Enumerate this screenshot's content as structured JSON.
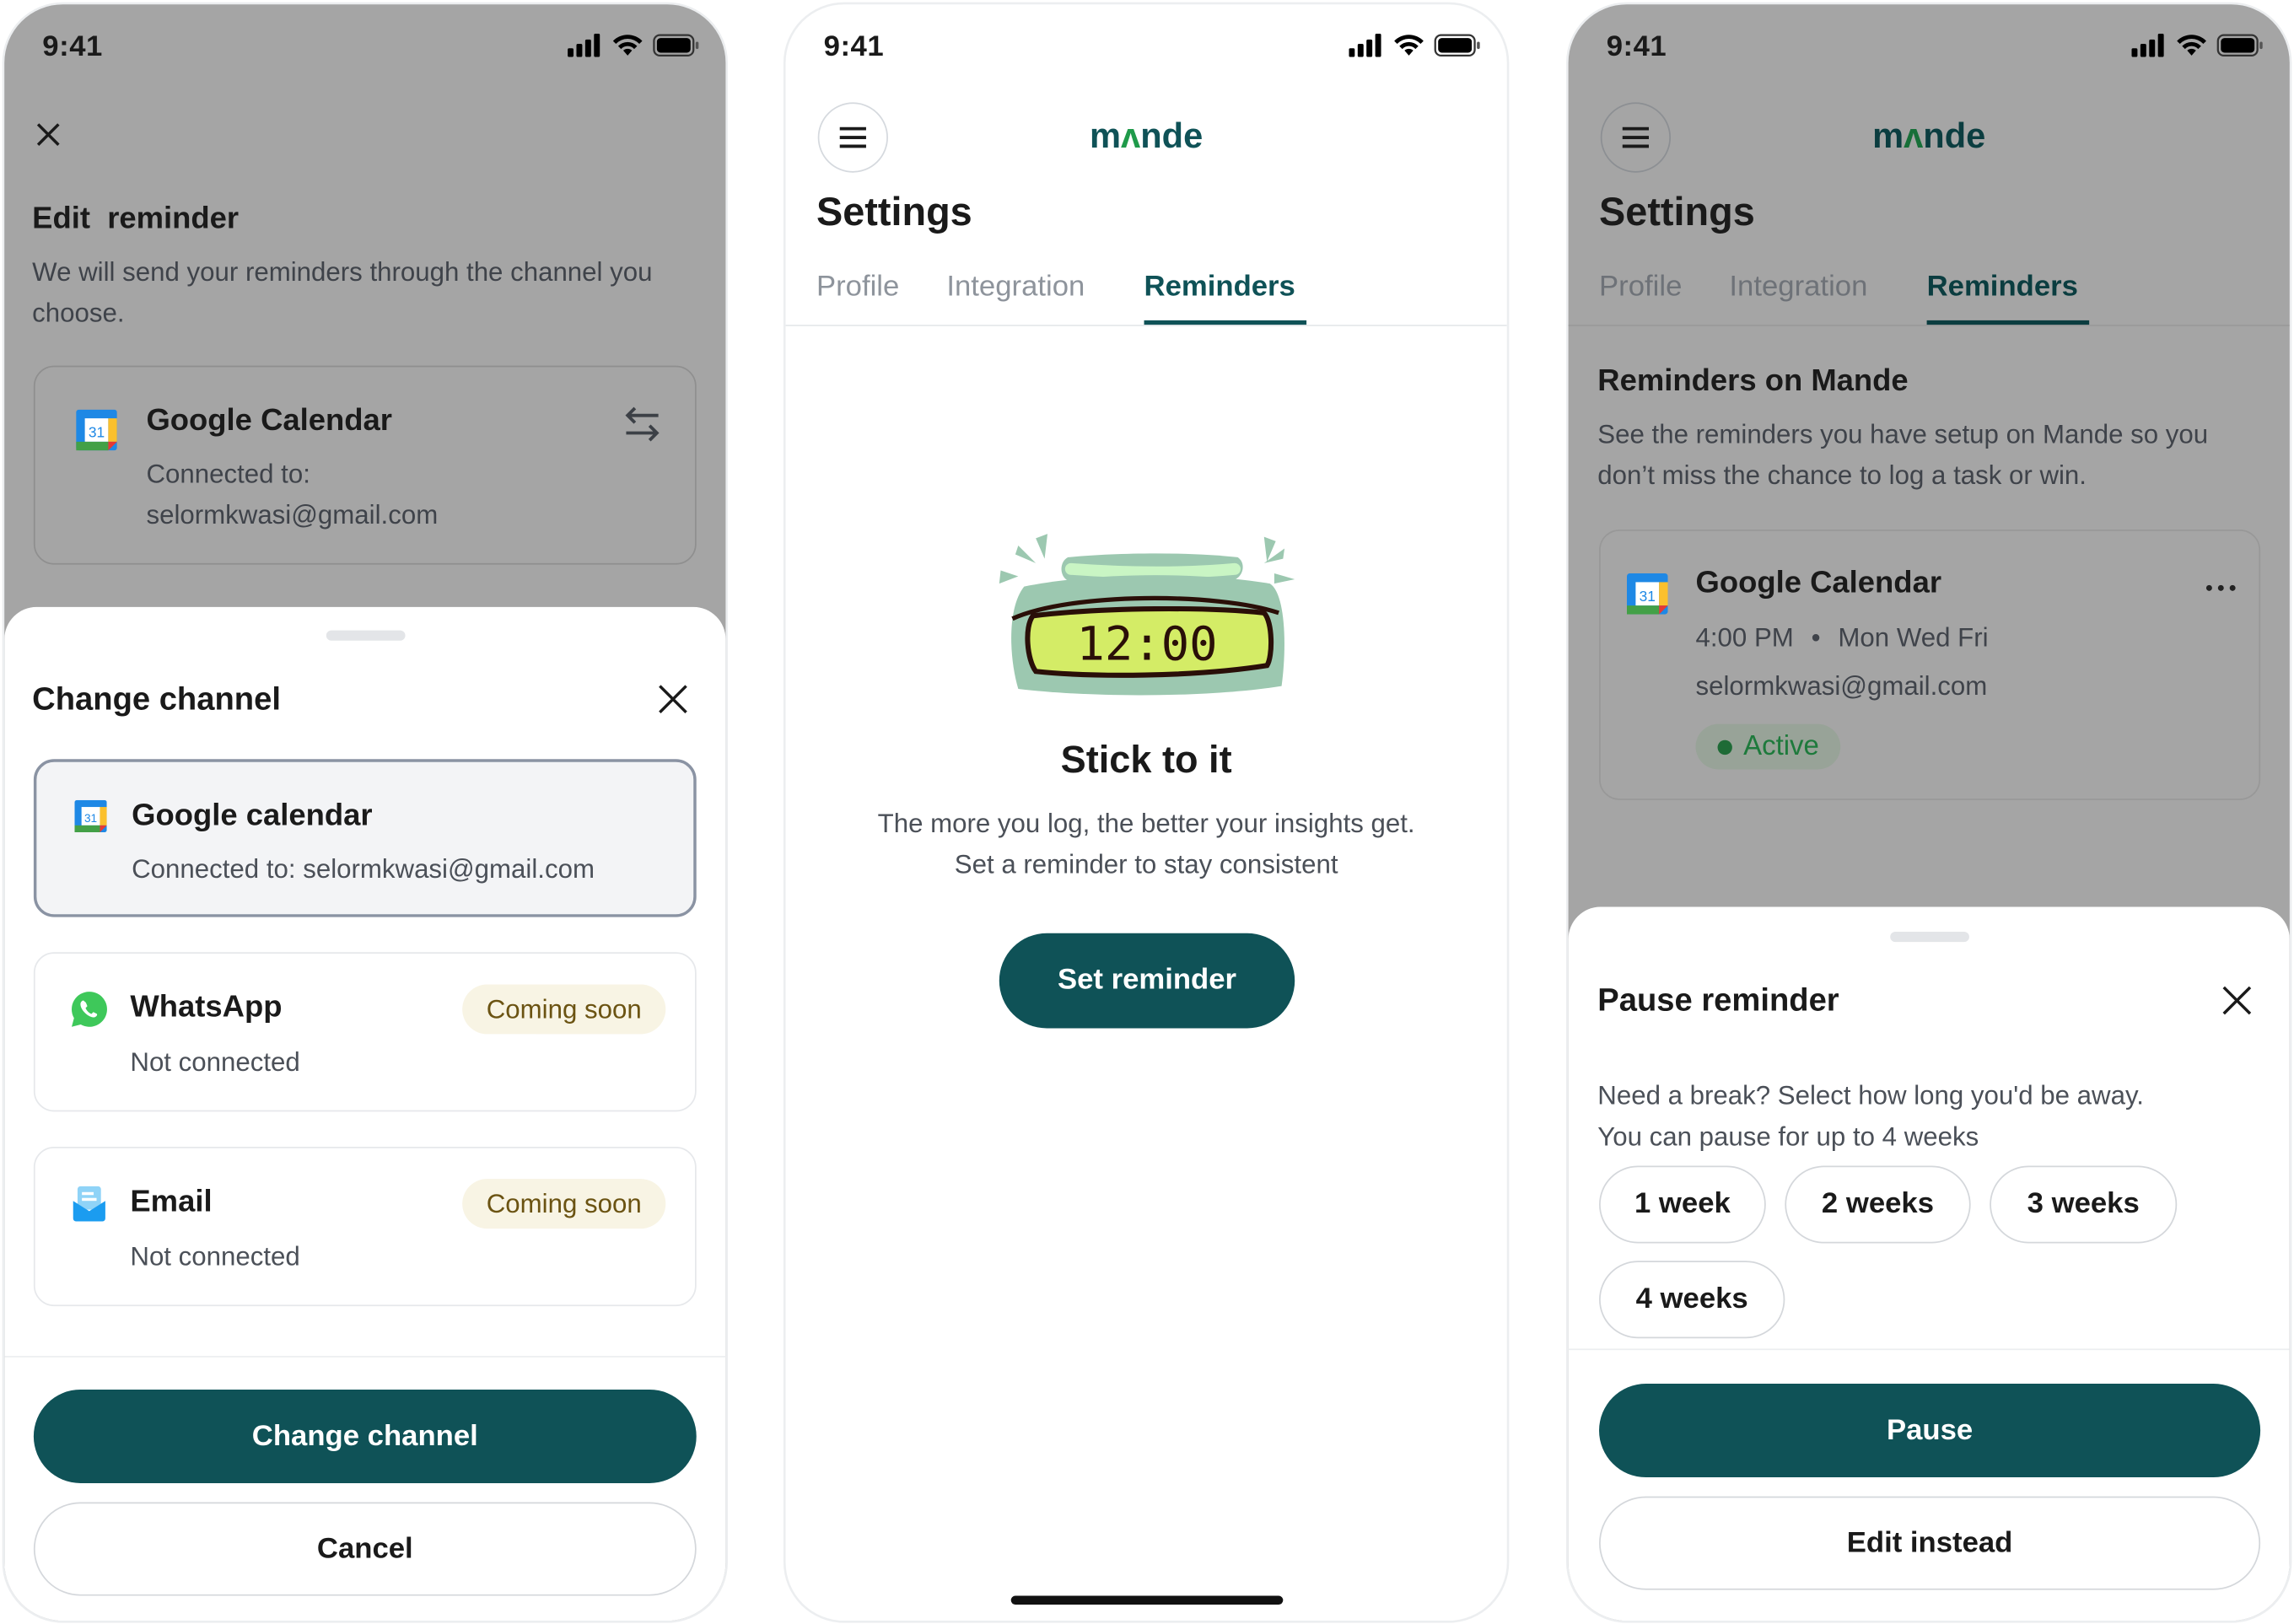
{
  "status_bar": {
    "time": "9:41"
  },
  "brand": {
    "logo": "mande",
    "accent": "#0f5257",
    "logo_accent": "#1f9a4a"
  },
  "screen1": {
    "title": "Edit  reminder",
    "description": "We will send your reminders through the channel you choose.",
    "current_channel": {
      "name": "Google Calendar",
      "connected_label": "Connected to:",
      "email": "selormkwasi@gmail.com",
      "icon": "google-calendar-icon",
      "action_icon": "swap-icon"
    },
    "sheet": {
      "title": "Change channel",
      "options": [
        {
          "name": "Google calendar",
          "subtitle": "Connected to: selormkwasi@gmail.com",
          "icon": "google-calendar-icon",
          "selected": true
        },
        {
          "name": "WhatsApp",
          "subtitle": "Not connected",
          "badge": "Coming soon",
          "icon": "whatsapp-icon"
        },
        {
          "name": "Email",
          "subtitle": "Not connected",
          "badge": "Coming soon",
          "icon": "email-icon"
        }
      ],
      "primary_button": "Change channel",
      "secondary_button": "Cancel"
    }
  },
  "settings": {
    "title": "Settings",
    "tabs": [
      {
        "label": "Profile"
      },
      {
        "label": "Integration"
      },
      {
        "label": "Reminders",
        "active": true
      }
    ]
  },
  "screen2": {
    "illustration": {
      "display": "12:00",
      "icon": "alarm-clock-illustration"
    },
    "heading": "Stick to it",
    "line1": "The more you log, the better your insights get.",
    "line2": "Set a reminder to stay consistent",
    "button": "Set reminder"
  },
  "screen3": {
    "section_title": "Reminders on Mande",
    "section_description_1": "See the reminders you have setup on Mande so you",
    "section_description_2": "don’t miss the chance to log a task or win.",
    "reminder": {
      "name": "Google Calendar",
      "time": "4:00 PM",
      "separator": "•",
      "days": "Mon Wed Fri",
      "email": "selormkwasi@gmail.com",
      "status": "Active",
      "status_color": "#1e7a3c"
    },
    "sheet": {
      "title": "Pause reminder",
      "line1": "Need a break? Select how long you'd be away.",
      "line2": "You can pause for up to 4 weeks",
      "options": [
        "1 week",
        "2 weeks",
        "3 weeks",
        "4 weeks"
      ],
      "primary_button": "Pause",
      "secondary_button": "Edit instead"
    }
  }
}
